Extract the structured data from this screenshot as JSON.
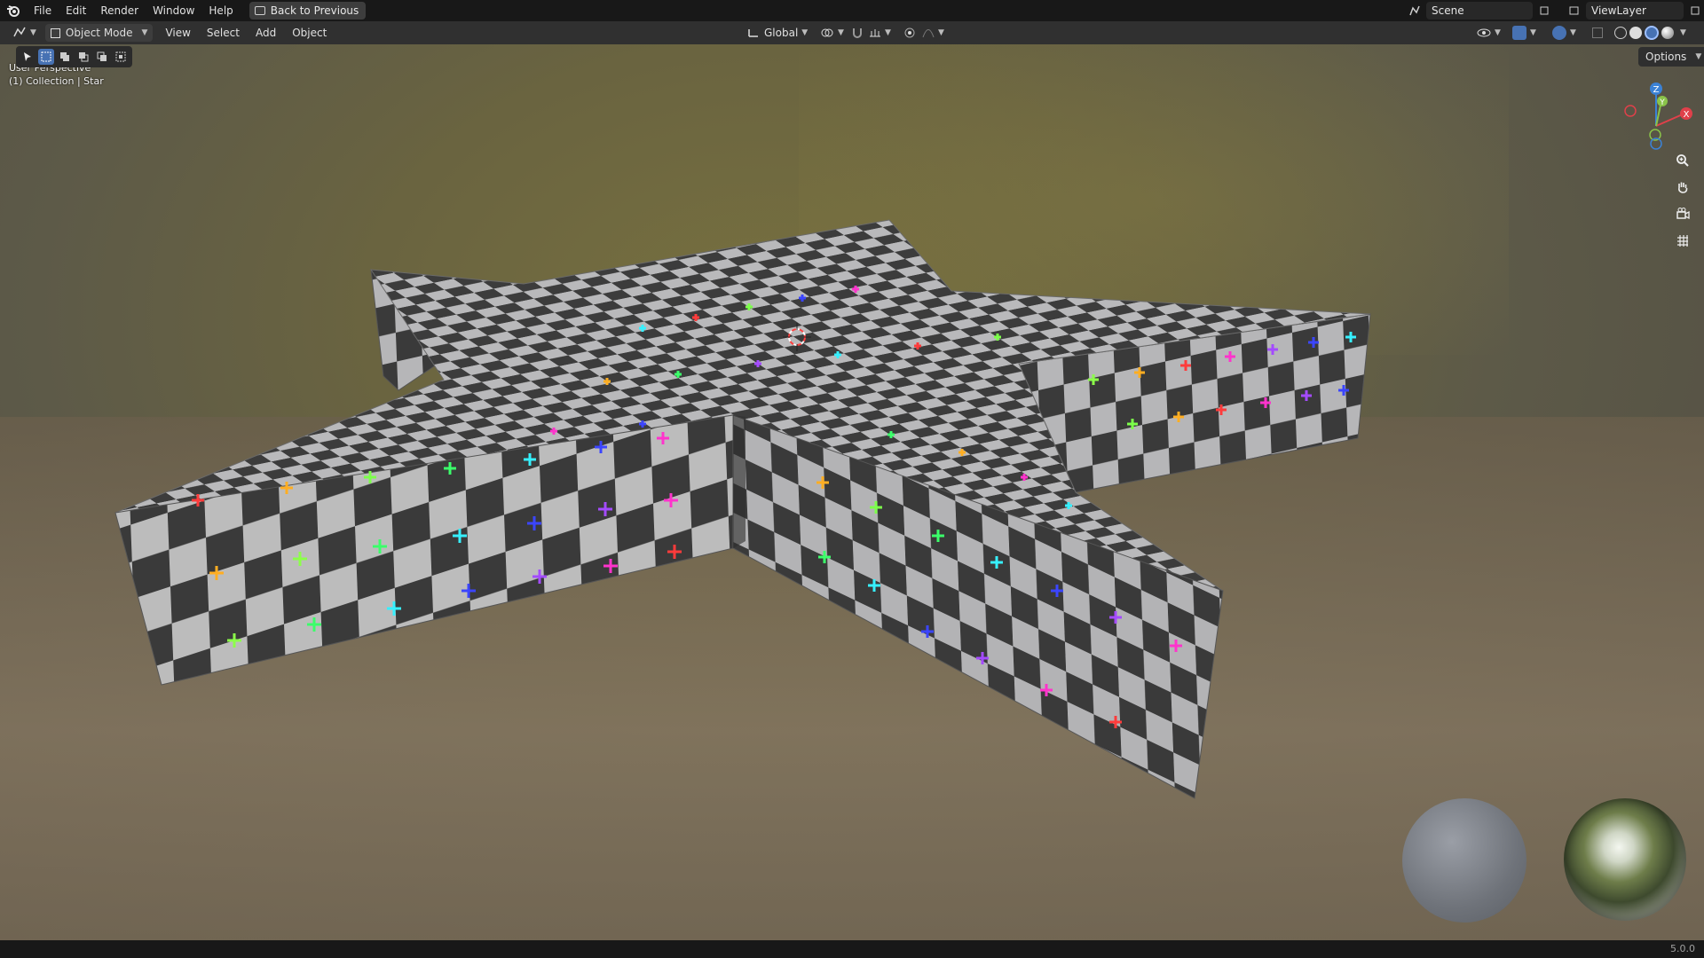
{
  "menu": {
    "items": [
      "File",
      "Edit",
      "Render",
      "Window",
      "Help"
    ],
    "back_label": "Back to Previous",
    "scene_name": "Scene",
    "view_layer_name": "ViewLayer"
  },
  "header": {
    "mode_label": "Object Mode",
    "menus": [
      "View",
      "Select",
      "Add",
      "Object"
    ],
    "orientation_label": "Global",
    "options_label": "Options"
  },
  "viewport": {
    "perspective_label": "User Perspective",
    "collection_label": "(1) Collection | Star",
    "object_name": "Star",
    "gizmo_axes": [
      "X",
      "Y",
      "Z"
    ]
  },
  "status": {
    "version": "5.0.0"
  },
  "colors": {
    "accent": "#4772b3",
    "axis_x": "#e0404a",
    "axis_y": "#8ac34a",
    "axis_z": "#3b82d6",
    "checker_dark": "#3a3a3a",
    "checker_light": "#b8b8b8"
  },
  "icons": {
    "blender_logo": "blender-logo-icon",
    "zoom": "zoom-icon",
    "pan": "hand-icon",
    "camera": "camera-icon",
    "grid": "grid-icon"
  }
}
